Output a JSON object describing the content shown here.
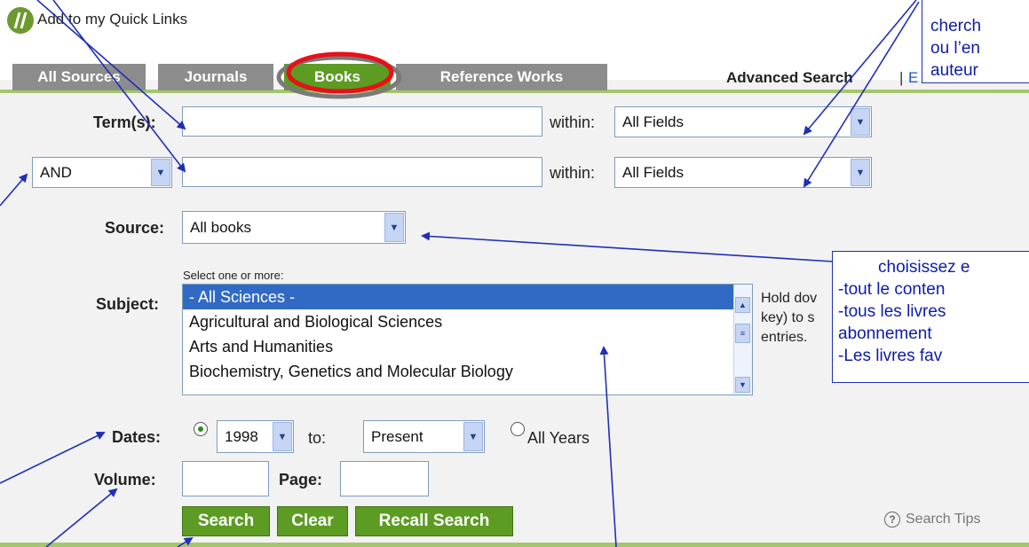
{
  "quicklinks": {
    "label": "Add to my Quick Links"
  },
  "tabs": [
    {
      "label": "All Sources"
    },
    {
      "label": "Journals"
    },
    {
      "label": "Books"
    },
    {
      "label": "Reference Works"
    }
  ],
  "advanced": {
    "label": "Advanced Search",
    "separator": "|",
    "more": "E"
  },
  "terms": {
    "label": "Term(s):",
    "within_label": "within:",
    "field1": "All Fields",
    "operator": "AND",
    "field2": "All Fields"
  },
  "source": {
    "label": "Source:",
    "value": "All books"
  },
  "subject": {
    "hint": "Select one or more:",
    "label": "Subject:",
    "items": [
      "- All Sciences -",
      "Agricultural and Biological Sciences",
      "Arts and Humanities",
      "Biochemistry, Genetics and Molecular Biology"
    ],
    "help_lines": [
      "Hold dov",
      "key) to s",
      "entries."
    ]
  },
  "dates": {
    "label": "Dates:",
    "from": "1998",
    "to_label": "to:",
    "to": "Present",
    "all_years": "All Years"
  },
  "volume": {
    "label": "Volume:",
    "page_label": "Page:"
  },
  "buttons": {
    "search": "Search",
    "clear": "Clear",
    "recall": "Recall Search"
  },
  "search_tips": "Search Tips",
  "callouts": {
    "top_lines": [
      "cherch",
      "ou l’en",
      "auteur"
    ],
    "right_lines": [
      "choisissez e",
      "-tout le conten",
      "-tous les livres",
      "abonnement",
      "-Les livres fav"
    ]
  },
  "colors": {
    "tab_green": "#5c9c23",
    "tab_grey": "#8c8c8c",
    "annotation_blue": "#1f2fb8",
    "highlight_red": "#e8101a"
  }
}
